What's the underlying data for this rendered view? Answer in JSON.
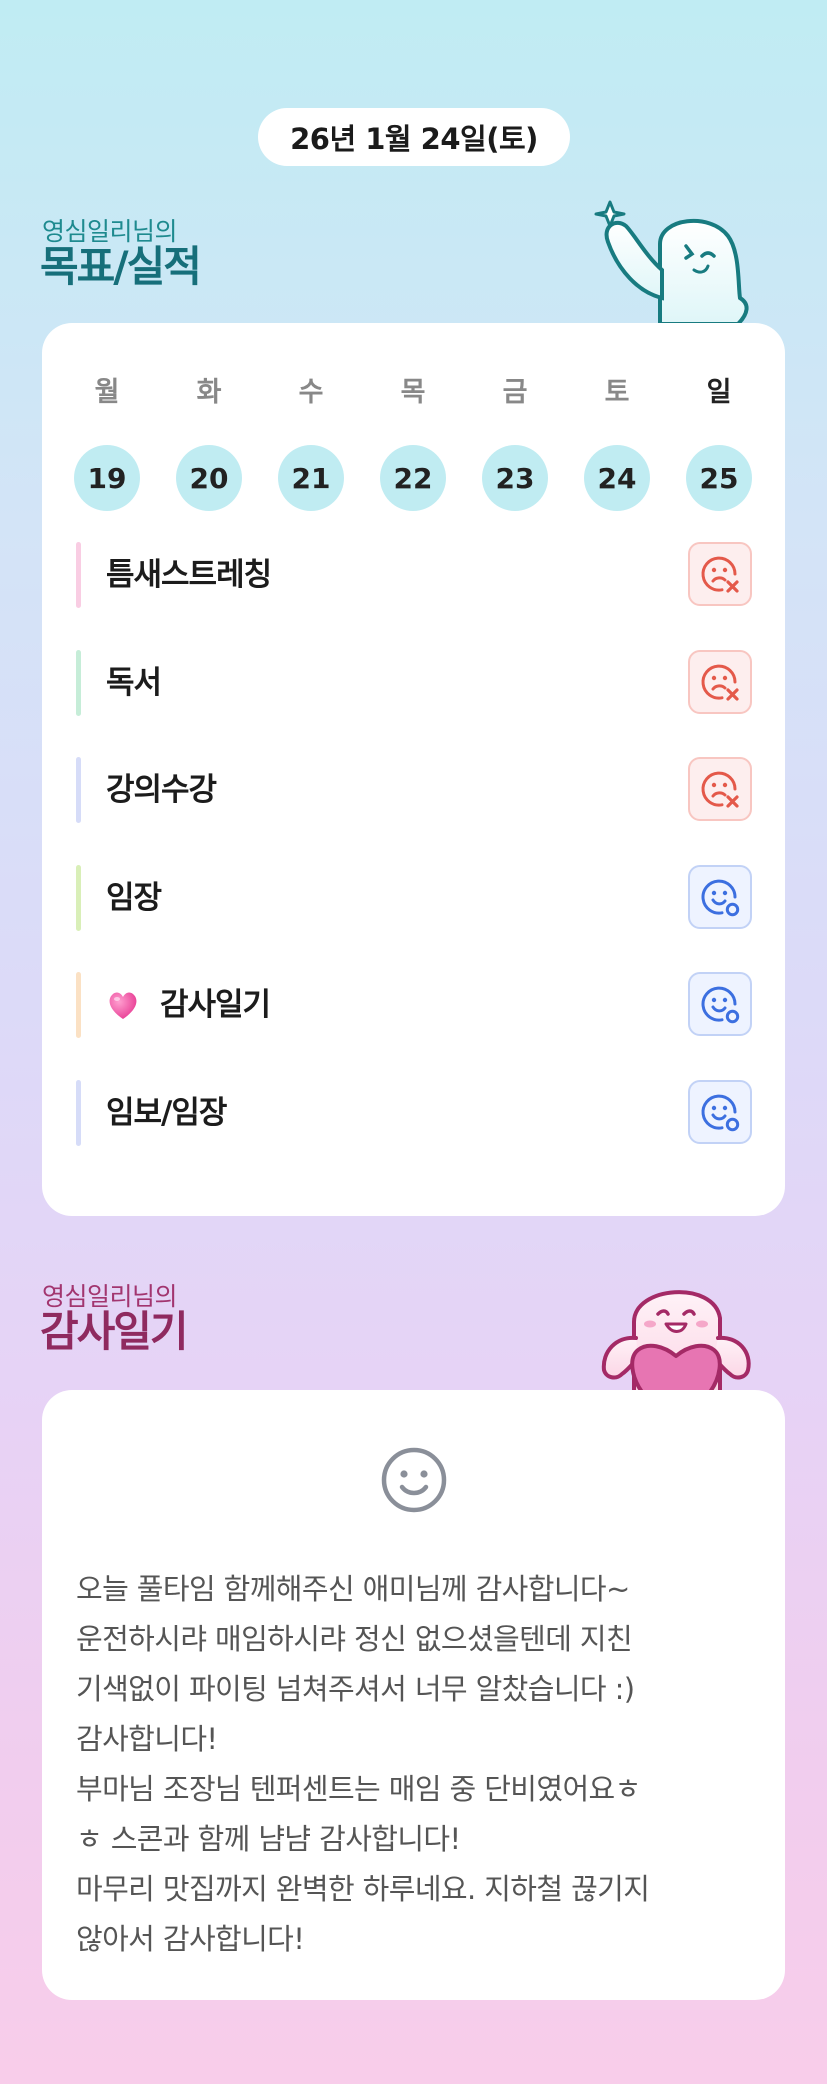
{
  "header": {
    "date": "26년 1월 24일(토)"
  },
  "goals_section": {
    "subtitle": "영심일리님의",
    "title": "목표/실적",
    "week": [
      {
        "day": "월",
        "date": "19"
      },
      {
        "day": "화",
        "date": "20"
      },
      {
        "day": "수",
        "date": "21"
      },
      {
        "day": "목",
        "date": "22"
      },
      {
        "day": "금",
        "date": "23"
      },
      {
        "day": "토",
        "date": "24"
      },
      {
        "day": "일",
        "date": "25"
      }
    ],
    "goals": [
      {
        "label": "틈새스트레칭",
        "bar_color": "#f9cde3",
        "status": "fail",
        "status_icon": "sad-face-x-icon"
      },
      {
        "label": "독서",
        "bar_color": "#c6edd8",
        "status": "fail",
        "status_icon": "sad-face-x-icon"
      },
      {
        "label": "강의수강",
        "bar_color": "#d6dcf8",
        "status": "fail",
        "status_icon": "sad-face-x-icon"
      },
      {
        "label": "임장",
        "bar_color": "#d9efb8",
        "status": "success",
        "status_icon": "smile-face-o-icon"
      },
      {
        "label": "감사일기",
        "bar_color": "#fbe1c4",
        "status": "success",
        "status_icon": "smile-face-o-icon",
        "emoji": "heart-emoji-icon"
      },
      {
        "label": "임보/임장",
        "bar_color": "#d6dcf8",
        "status": "success",
        "status_icon": "smile-face-o-icon"
      }
    ]
  },
  "gratitude_section": {
    "subtitle": "영심일리님의",
    "title": "감사일기",
    "mood_icon": "smile-face-icon",
    "text": "오늘 풀타임 함께해주신 애미님께 감사합니다~\n운전하시랴 매임하시랴 정신 없으셨을텐데 지친\n기색없이 파이팅 넘쳐주셔서 너무 알찼습니다 :)\n감사합니다!\n부마님 조장님 텐퍼센트는 매임 중 단비였어요ㅎ\nㅎ 스콘과 함께 냠냠 감사합니다!\n마무리 맛집까지 완벽한 하루네요. 지하철 끊기지\n않아서 감사합니다!"
  },
  "colors": {
    "fail": "#e4594a",
    "success": "#3c6fe0",
    "goals_title": "#166f7a",
    "gratitude_title": "#8f2a5f",
    "date_circle": "#c0ecf2"
  }
}
